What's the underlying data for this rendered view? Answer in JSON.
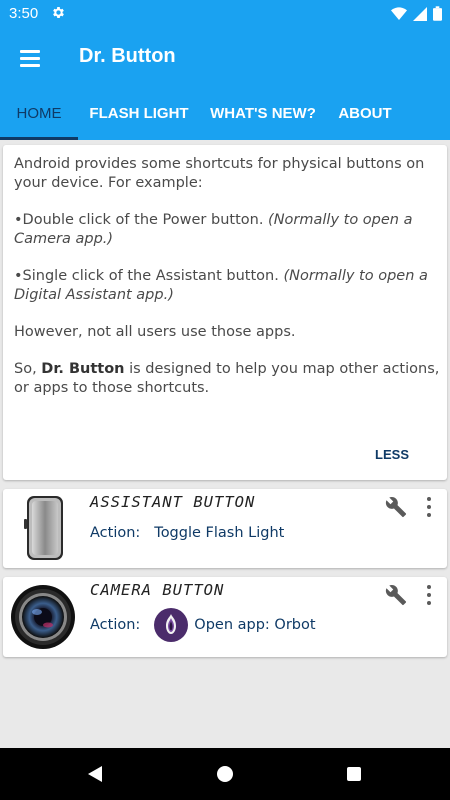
{
  "status_bar": {
    "time": "3:50",
    "settings_icon": "gear-icon",
    "wifi_icon": "wifi-icon",
    "signal_icon": "signal-icon",
    "battery_icon": "battery-icon"
  },
  "app_bar": {
    "title": "Dr. Button",
    "menu_icon": "hamburger-icon",
    "color": "#1aa2f1"
  },
  "tabs": [
    {
      "label": "HOME",
      "active": true
    },
    {
      "label": "FLASH LIGHT",
      "active": false
    },
    {
      "label": "WHAT'S NEW?",
      "active": false
    },
    {
      "label": "ABOUT",
      "active": false
    }
  ],
  "intro": {
    "p1": "Android provides some shortcuts for physical buttons on your device. For example:",
    "bullet1_text": "•Double click of the Power button. ",
    "bullet1_note": "(Normally to open a Camera app.)",
    "bullet2_text": "•Single click of the Assistant button. ",
    "bullet2_note": "(Normally to open a Digital Assistant app.)",
    "p3": "However, not all users use those apps.",
    "p4_before": "So, ",
    "p4_bold": "Dr. Button",
    "p4_after": " is designed to help you map other actions, or apps to those shortcuts.",
    "less_label": "LESS"
  },
  "assistant_card": {
    "title": "ASSISTANT BUTTON",
    "action_label": "Action:",
    "action_value": "Toggle Flash Light"
  },
  "camera_card": {
    "title": "CAMERA BUTTON",
    "action_label": "Action:",
    "action_value": "Open app: Orbot"
  },
  "nav_bar": {
    "back_icon": "back-triangle-icon",
    "home_icon": "home-circle-icon",
    "recents_icon": "recents-square-icon"
  },
  "colors": {
    "accent": "#1aa2f1",
    "dark_blue": "#0f3a66",
    "background": "#e9e9e9"
  }
}
